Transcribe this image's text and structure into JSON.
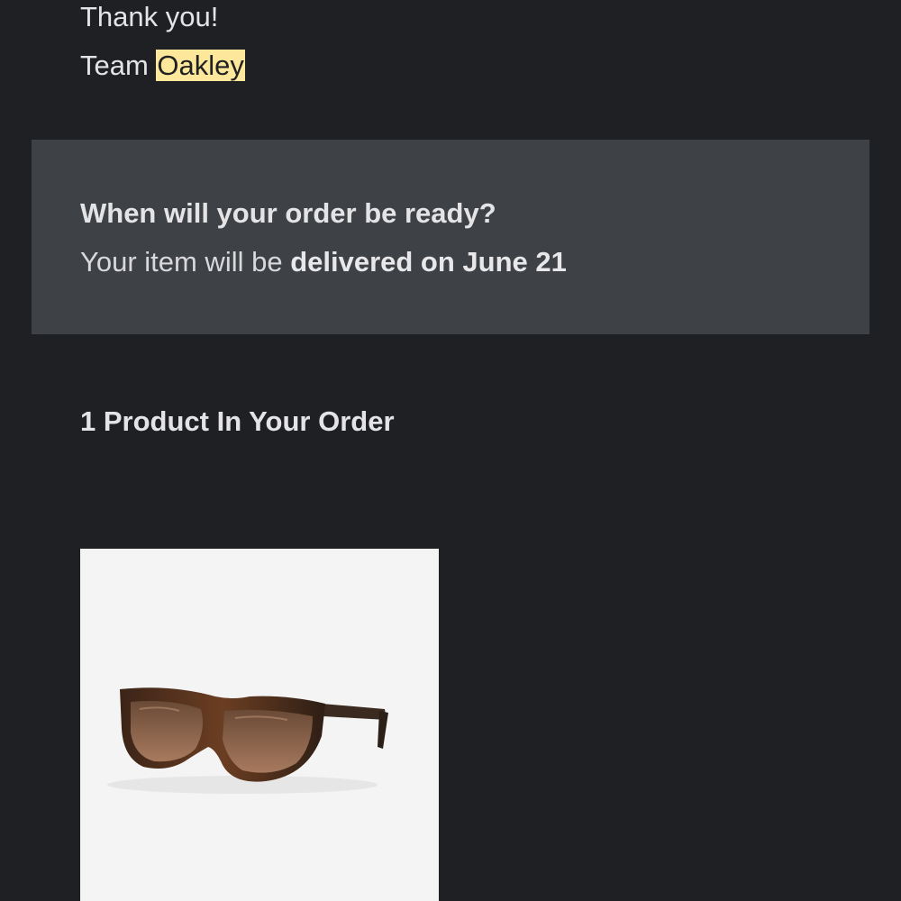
{
  "signoff": {
    "thanks": "Thank you!",
    "team_prefix": "Team ",
    "team_name": "Oakley"
  },
  "delivery": {
    "question": "When will your order be ready?",
    "text_prefix": "Your item will be ",
    "text_bold": "delivered on June 21"
  },
  "products": {
    "heading": "1 Product In Your Order",
    "items": [
      {
        "image": "sunglasses-product-image"
      }
    ]
  },
  "colors": {
    "background": "#1f2024",
    "panel": "#3e4145",
    "highlight": "#fde79a",
    "card": "#f4f4f4"
  }
}
